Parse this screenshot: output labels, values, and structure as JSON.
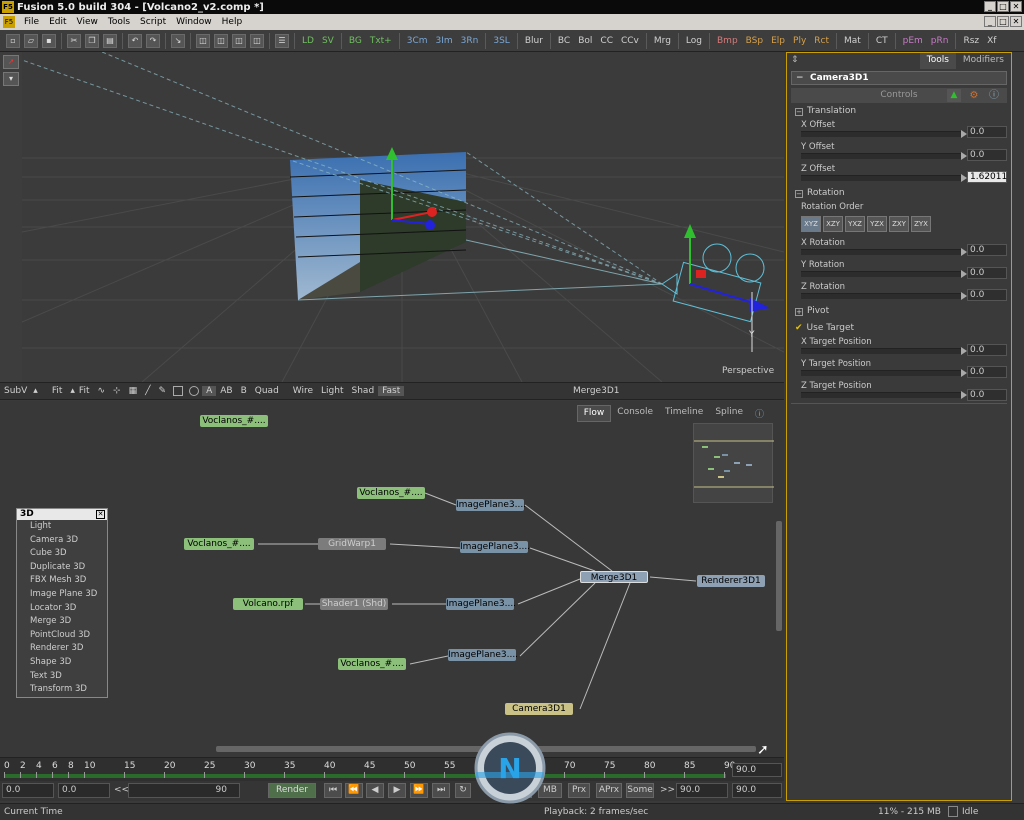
{
  "window": {
    "title": "Fusion 5.0 build 304 - [Volcano2_v2.comp *]",
    "app_icon": "F5",
    "min": "_",
    "max": "□",
    "close": "✕"
  },
  "menu": [
    "File",
    "Edit",
    "View",
    "Tools",
    "Script",
    "Window",
    "Help"
  ],
  "toolbar": {
    "buttons": [
      "LD",
      "SV",
      "BG",
      "Txt+",
      "3Cm",
      "3Im",
      "3Rn",
      "3SL",
      "Blur",
      "BC",
      "Bol",
      "CC",
      "CCv",
      "Mrg",
      "Log",
      "Bmp",
      "BSp",
      "Elp",
      "Ply",
      "Rct",
      "Mat",
      "CT",
      "pEm",
      "pRn",
      "Rsz",
      "Xf"
    ]
  },
  "viewport": {
    "label": "Perspective",
    "axis_y": "Y"
  },
  "viewport_tools": {
    "subv": "SubV",
    "fit": "Fit",
    "fit2": "Fit",
    "a_icon": "A",
    "ab_icon": "AB",
    "b_icon": "B",
    "quad": "Quad",
    "wire": "Wire",
    "light": "Light",
    "shad": "Shad",
    "fast": "Fast",
    "view_name": "Merge3D1"
  },
  "flow_tabs": [
    "Flow",
    "Console",
    "Timeline",
    "Spline"
  ],
  "nodes": {
    "n1": "Voclanos_#....",
    "n2": "Voclanos_#....",
    "n3": "ImagePlane3....",
    "n4": "Voclanos_#....",
    "n5": "GridWarp1",
    "n6": "ImagePlane3....",
    "n7": "Merge3D1",
    "n8": "Renderer3D1",
    "n9": "Volcano.rpf",
    "n10": "Shader1 (Shd)",
    "n11": "ImagePlane3....",
    "n12": "Voclanos_#....",
    "n13": "ImagePlane3....",
    "n14": "Camera3D1"
  },
  "menu3d": {
    "title": "3D",
    "close": "✕",
    "items": [
      "Light",
      "Camera 3D",
      "Cube 3D",
      "Duplicate 3D",
      "FBX Mesh 3D",
      "Image Plane 3D",
      "Locator 3D",
      "Merge 3D",
      "PointCloud 3D",
      "Renderer 3D",
      "Shape 3D",
      "Text 3D",
      "Transform 3D"
    ]
  },
  "timeline": {
    "ticks": [
      "0",
      "2",
      "4",
      "6",
      "8",
      "10",
      "15",
      "20",
      "25",
      "30",
      "35",
      "40",
      "45",
      "50",
      "55",
      "60",
      "65",
      "70",
      "75",
      "80",
      "85",
      "90"
    ],
    "end": "90.0"
  },
  "playback": {
    "start_field": "0.0",
    "current_field": "0.0",
    "range_end": "90",
    "render": "Render",
    "hq": "HQ",
    "mb": "MB",
    "prx": "Prx",
    "aprx": "APrx",
    "some": "Some",
    "end1": "90.0",
    "end2": "90.0",
    "rewind": "<<",
    "ff": ">>"
  },
  "status": {
    "left": "Current Time",
    "playback": "Playback: 2 frames/sec",
    "memory": "11% - 215 MB",
    "state": "Idle"
  },
  "panel": {
    "tabs": [
      "Tools",
      "Modifiers"
    ],
    "tool_name": "Camera3D1",
    "controls": "Controls",
    "translation": "Translation",
    "x_offset": "X Offset",
    "x_offset_val": "0.0",
    "y_offset": "Y Offset",
    "y_offset_val": "0.0",
    "z_offset": "Z Offset",
    "z_offset_val": "1.62011",
    "rotation": "Rotation",
    "rotation_order": "Rotation Order",
    "orders": [
      "XYZ",
      "XZY",
      "YXZ",
      "YZX",
      "ZXY",
      "ZYX"
    ],
    "x_rot": "X Rotation",
    "x_rot_val": "0.0",
    "y_rot": "Y Rotation",
    "y_rot_val": "0.0",
    "z_rot": "Z Rotation",
    "z_rot_val": "0.0",
    "pivot": "Pivot",
    "use_target": "Use Target",
    "x_target": "X Target Position",
    "x_target_val": "0.0",
    "y_target": "Y Target Position",
    "y_target_val": "0.0",
    "z_target": "Z Target Position",
    "z_target_val": "0.0"
  },
  "colors": {
    "accent": "#c9a000",
    "loader_node": "#8bbf7a",
    "camera_node": "#c9c186"
  }
}
